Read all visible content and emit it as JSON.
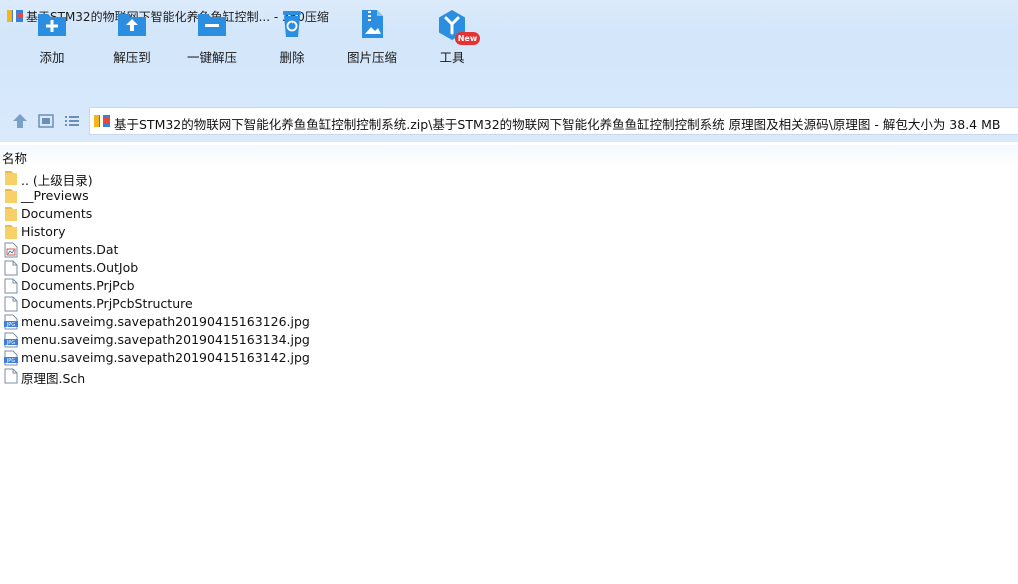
{
  "window": {
    "title": "基于STM32的物联网下智能化养鱼鱼缸控制... - 360压缩"
  },
  "toolbar": {
    "buttons": [
      {
        "label": "添加",
        "icon": "add-icon"
      },
      {
        "label": "解压到",
        "icon": "extract-to-icon"
      },
      {
        "label": "一键解压",
        "icon": "one-click-extract-icon"
      },
      {
        "label": "删除",
        "icon": "delete-icon"
      },
      {
        "label": "图片压缩",
        "icon": "image-compress-icon"
      },
      {
        "label": "工具",
        "icon": "tools-icon"
      }
    ],
    "new_badge": "New"
  },
  "address": {
    "path": "基于STM32的物联网下智能化养鱼鱼缸控制控制系统.zip\\基于STM32的物联网下智能化养鱼鱼缸控制控制系统 原理图及相关源码\\原理图 - 解包大小为 38.4 MB"
  },
  "columns": {
    "name": "名称"
  },
  "files": [
    {
      "name": ".. (上级目录)",
      "type": "folder"
    },
    {
      "name": "__Previews",
      "type": "folder"
    },
    {
      "name": "Documents",
      "type": "folder"
    },
    {
      "name": "History",
      "type": "folder"
    },
    {
      "name": "Documents.Dat",
      "type": "dat"
    },
    {
      "name": "Documents.OutJob",
      "type": "file"
    },
    {
      "name": "Documents.PrjPcb",
      "type": "file"
    },
    {
      "name": "Documents.PrjPcbStructure",
      "type": "file"
    },
    {
      "name": "menu.saveimg.savepath20190415163126.jpg",
      "type": "jpg"
    },
    {
      "name": "menu.saveimg.savepath20190415163134.jpg",
      "type": "jpg"
    },
    {
      "name": "menu.saveimg.savepath20190415163142.jpg",
      "type": "jpg"
    },
    {
      "name": "原理图.Sch",
      "type": "file"
    }
  ],
  "colors": {
    "accent": "#2b8ee0",
    "titlebar": "#d8e9fb"
  }
}
